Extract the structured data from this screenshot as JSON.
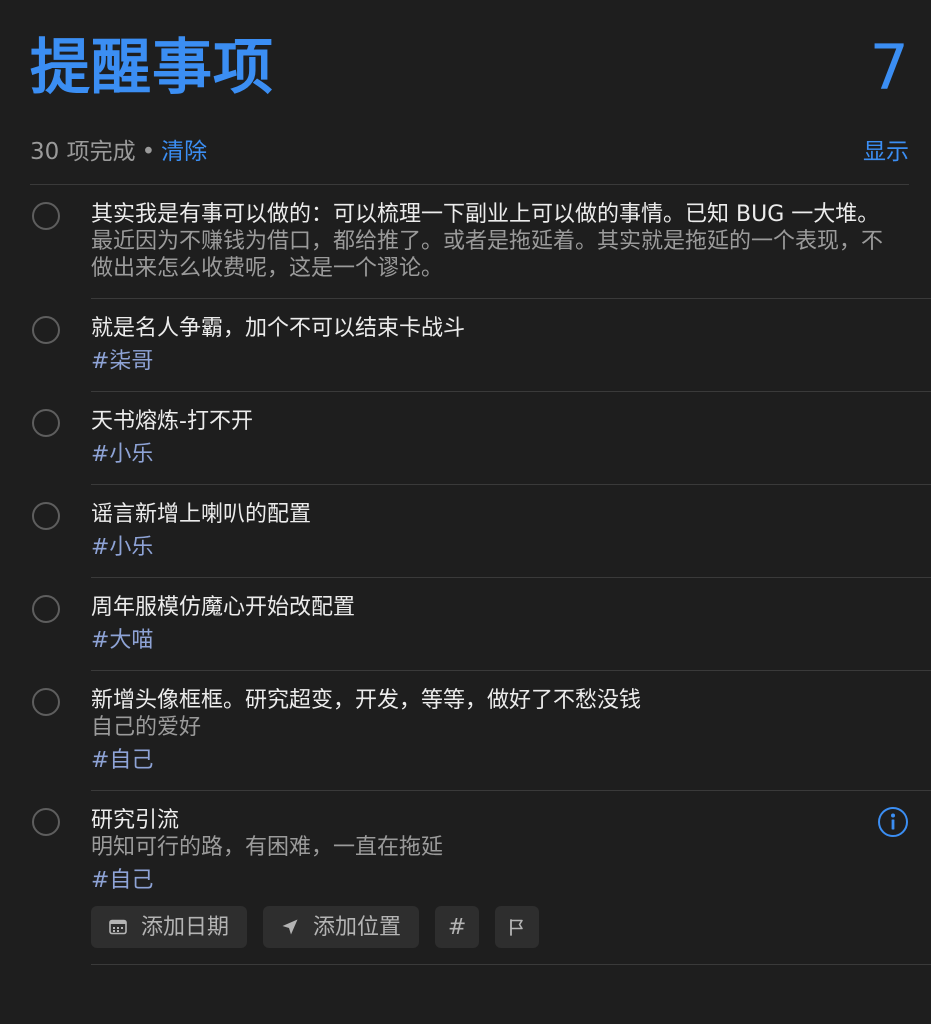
{
  "header": {
    "title": "提醒事项",
    "count": "7"
  },
  "summary": {
    "completed": "30 项完成",
    "dot": "•",
    "clear": "清除",
    "show": "显示"
  },
  "items": [
    {
      "title": "其实我是有事可以做的：可以梳理一下副业上可以做的事情。已知 BUG 一大堆。",
      "note": "最近因为不赚钱为借口，都给推了。或者是拖延着。其实就是拖延的一个表现，不做出来怎么收费呢，这是一个谬论。"
    },
    {
      "title": "就是名人争霸，加个不可以结束卡战斗",
      "tag": "#柒哥"
    },
    {
      "title": "天书熔炼-打不开",
      "tag": "#小乐"
    },
    {
      "title": "谣言新增上喇叭的配置",
      "tag": "#小乐"
    },
    {
      "title": "周年服模仿魔心开始改配置",
      "tag": "#大喵"
    },
    {
      "title": "新增头像框框。研究超变，开发，等等，做好了不愁没钱",
      "note": "自己的爱好",
      "tag": "#自己"
    },
    {
      "title": "研究引流",
      "note": "明知可行的路，有困难，一直在拖延",
      "tag": "#自己"
    }
  ],
  "actions": {
    "add_date": "添加日期",
    "add_location": "添加位置",
    "tag_symbol": "#"
  },
  "icons": {
    "info": "info-icon",
    "calendar": "calendar-icon",
    "location": "location-arrow-icon",
    "flag": "flag-icon"
  },
  "colors": {
    "accent": "#3b8ef3",
    "background": "#1e1e1e",
    "tag": "#8ea3d6"
  }
}
